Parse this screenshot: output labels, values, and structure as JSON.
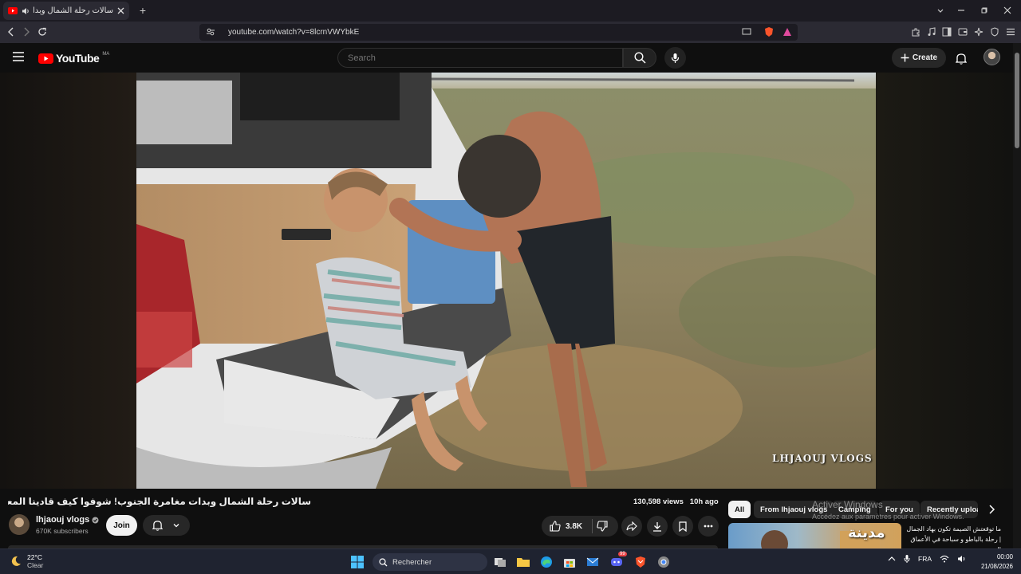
{
  "browser": {
    "tab_title": "سالات رحلة الشمال وبدات مغا...",
    "new_tab_symbol": "+",
    "url": "youtube.com/watch?v=8lcrnVWYbkE"
  },
  "header": {
    "logo_text": "YouTube",
    "country_code": "MA",
    "search_placeholder": "Search",
    "create_label": "Create"
  },
  "video": {
    "watermark": "LHJAOUJ VLOGS",
    "title": "سالات رحلة الشمال وبدات مغامرة الجنوب! شوفوا كيف قادينا المعدات كاملة 💸 🔥",
    "views": "130,598 views",
    "age": "10h ago"
  },
  "channel": {
    "name": "lhjaouj vlogs",
    "subscribers": "670K subscribers",
    "join_label": "Join"
  },
  "actions": {
    "likes": "3.8K"
  },
  "chips": [
    {
      "label": "All",
      "active": true
    },
    {
      "label": "From lhjaouj vlogs",
      "active": false
    },
    {
      "label": "Camping",
      "active": false
    },
    {
      "label": "For you",
      "active": false
    },
    {
      "label": "Recently uploaded",
      "active": false
    }
  ],
  "windows_overlay": {
    "line1": "Activer Windows",
    "line2": "Accédez aux paramètres pour activer Windows."
  },
  "recommended": {
    "thumb_text": "مدينة",
    "title": "ما توقعتش الصيمة تكون بهاد الجمال | رحلة بالباطو و سباحة في الأعماق البحر"
  },
  "taskbar": {
    "temperature": "22°C",
    "weather": "Clear",
    "search_label": "Rechercher",
    "language": "FRA",
    "time": "00:00",
    "date": "21/08/2026",
    "discord_badge": "99"
  },
  "colors": {
    "yt_red": "#ff0000",
    "background": "#0f0f0f",
    "chip_bg": "#272727",
    "brave_orange": "#fb542b"
  }
}
